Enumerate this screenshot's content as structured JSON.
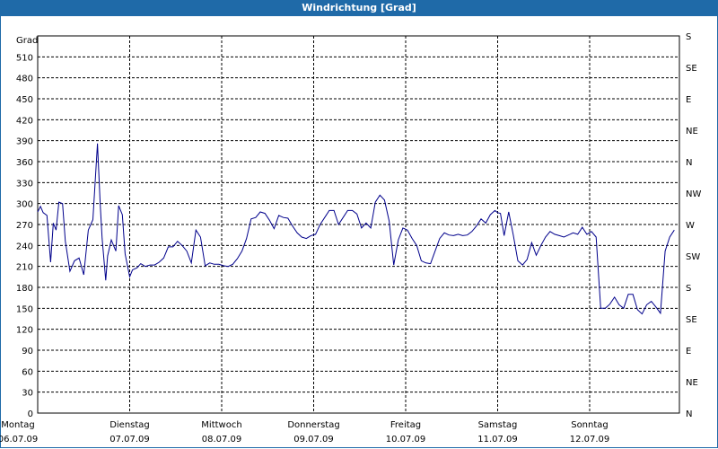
{
  "window": {
    "title": "Windrichtung [Grad]"
  },
  "colors": {
    "title_bar": "#1f6aa8",
    "series": "#00008b",
    "grid": "#000000"
  },
  "chart_data": {
    "type": "line",
    "title": "Windrichtung [Grad]",
    "ylabel": "Grad",
    "ylim": [
      0,
      540
    ],
    "yticks": [
      0,
      30,
      60,
      90,
      120,
      150,
      180,
      210,
      240,
      270,
      300,
      330,
      360,
      390,
      420,
      450,
      480,
      510
    ],
    "right_axis_labels": [
      "N",
      "NE",
      "E",
      "SE",
      "S",
      "SW",
      "W",
      "NW",
      "N",
      "NE",
      "E",
      "SE",
      "S"
    ],
    "x_categories": [
      {
        "day": "Montag",
        "date": "06.07.09"
      },
      {
        "day": "Dienstag",
        "date": "07.07.09"
      },
      {
        "day": "Mittwoch",
        "date": "08.07.09"
      },
      {
        "day": "Donnerstag",
        "date": "09.07.09"
      },
      {
        "day": "Freitag",
        "date": "10.07.09"
      },
      {
        "day": "Samstag",
        "date": "11.07.09"
      },
      {
        "day": "Sonntag",
        "date": "12.07.09"
      }
    ],
    "grid": true,
    "series": [
      {
        "days": [
          0,
          0.03,
          0.06,
          0.1,
          0.14,
          0.17,
          0.2,
          0.23,
          0.27,
          0.3,
          0.35,
          0.4,
          0.45,
          0.5,
          0.55,
          0.6,
          0.65,
          0.68,
          0.7,
          0.74,
          0.76,
          0.8,
          0.85,
          0.88,
          0.92,
          0.95,
          1.0,
          1.03,
          1.08,
          1.12,
          1.17,
          1.22,
          1.27,
          1.32,
          1.37,
          1.42,
          1.47,
          1.52,
          1.57,
          1.62,
          1.67,
          1.72,
          1.77,
          1.82,
          1.87,
          1.92,
          1.97,
          2.02,
          2.07,
          2.12,
          2.17,
          2.22,
          2.27,
          2.32,
          2.37,
          2.42,
          2.47,
          2.52,
          2.57,
          2.62,
          2.67,
          2.72,
          2.77,
          2.82,
          2.87,
          2.92,
          2.97,
          3.02,
          3.07,
          3.12,
          3.17,
          3.22,
          3.27,
          3.32,
          3.37,
          3.42,
          3.47,
          3.52,
          3.57,
          3.62,
          3.67,
          3.72,
          3.77,
          3.82,
          3.87,
          3.92,
          3.97,
          4.02,
          4.07,
          4.12,
          4.17,
          4.22,
          4.27,
          4.32,
          4.37,
          4.42,
          4.47,
          4.52,
          4.57,
          4.62,
          4.67,
          4.72,
          4.77,
          4.82,
          4.87,
          4.92,
          4.97,
          5.0,
          5.03,
          5.07,
          5.12,
          5.17,
          5.22,
          5.27,
          5.32,
          5.37,
          5.42,
          5.47,
          5.52,
          5.57,
          5.62,
          5.67,
          5.72,
          5.77,
          5.82,
          5.87,
          5.92,
          5.97,
          6.02,
          6.07,
          6.12,
          6.17,
          6.22,
          6.27,
          6.32,
          6.37,
          6.42,
          6.47,
          6.52,
          6.57,
          6.62,
          6.67,
          6.72,
          6.77,
          6.82,
          6.87,
          6.92
        ],
        "values": [
          288,
          296,
          287,
          283,
          216,
          272,
          262,
          302,
          300,
          246,
          203,
          218,
          222,
          198,
          262,
          277,
          386,
          298,
          250,
          190,
          225,
          248,
          232,
          297,
          284,
          228,
          195,
          205,
          208,
          214,
          210,
          212,
          212,
          216,
          222,
          238,
          238,
          246,
          240,
          232,
          215,
          262,
          252,
          211,
          215,
          213,
          213,
          211,
          210,
          213,
          221,
          232,
          250,
          278,
          280,
          288,
          286,
          276,
          264,
          283,
          280,
          279,
          268,
          258,
          252,
          250,
          254,
          256,
          270,
          280,
          290,
          290,
          270,
          280,
          290,
          290,
          285,
          265,
          272,
          265,
          302,
          312,
          305,
          275,
          212,
          248,
          265,
          262,
          250,
          240,
          218,
          215,
          214,
          232,
          250,
          258,
          255,
          254,
          256,
          254,
          255,
          260,
          268,
          278,
          272,
          284,
          290,
          287,
          286,
          254,
          288,
          255,
          218,
          212,
          220,
          244,
          226,
          240,
          252,
          260,
          256,
          254,
          252,
          255,
          258,
          256,
          266,
          256,
          260,
          252,
          150,
          150,
          156,
          166,
          155,
          150,
          170,
          170,
          148,
          142,
          155,
          160,
          152,
          143,
          232,
          252,
          262,
          288,
          275,
          267,
          264
        ]
      }
    ]
  }
}
